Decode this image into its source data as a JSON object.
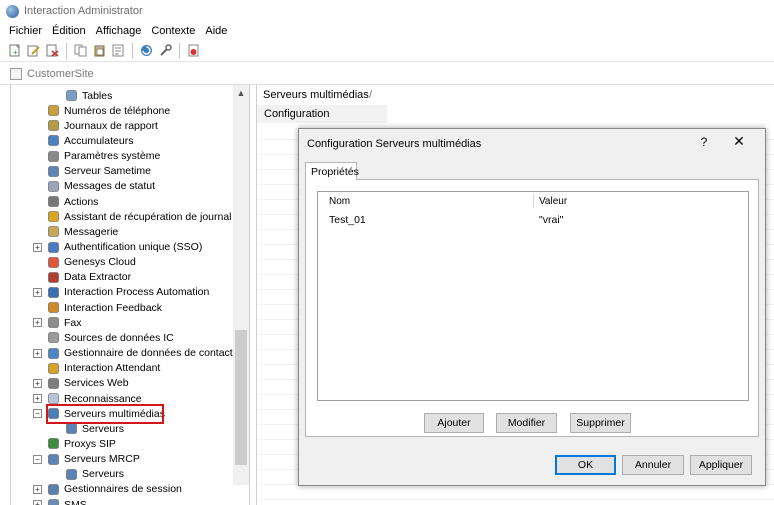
{
  "window": {
    "title": "Interaction Administrator"
  },
  "menu": [
    "Fichier",
    "Édition",
    "Affichage",
    "Contexte",
    "Aide"
  ],
  "site": {
    "name": "CustomerSite"
  },
  "tree": {
    "items": [
      {
        "label": "Tables",
        "icon": "table-icon"
      },
      {
        "label": "Numéros de téléphone",
        "icon": "phone-numbers-icon"
      },
      {
        "label": "Journaux de rapport",
        "icon": "report-logs-icon"
      },
      {
        "label": "Accumulateurs",
        "icon": "accumulators-icon"
      },
      {
        "label": "Paramètres système",
        "icon": "system-parameters-icon"
      },
      {
        "label": "Serveur Sametime",
        "icon": "sametime-server-icon"
      },
      {
        "label": "Messages de statut",
        "icon": "status-messages-icon"
      },
      {
        "label": "Actions",
        "icon": "actions-icon"
      },
      {
        "label": "Assistant de récupération de journal",
        "icon": "log-retrieval-icon"
      },
      {
        "label": "Messagerie",
        "icon": "messaging-icon"
      },
      {
        "label": "Authentification unique (SSO)",
        "icon": "sso-icon"
      },
      {
        "label": "Genesys Cloud",
        "icon": "genesys-cloud-icon"
      },
      {
        "label": "Data Extractor",
        "icon": "data-extractor-icon"
      },
      {
        "label": "Interaction Process Automation",
        "icon": "ipa-icon"
      },
      {
        "label": "Interaction Feedback",
        "icon": "feedback-icon"
      },
      {
        "label": "Fax",
        "icon": "fax-icon"
      },
      {
        "label": "Sources de données IC",
        "icon": "data-sources-icon"
      },
      {
        "label": "Gestionnaire de données de contact",
        "icon": "contact-data-icon"
      },
      {
        "label": "Interaction Attendant",
        "icon": "attendant-icon"
      },
      {
        "label": "Services Web",
        "icon": "web-services-icon"
      },
      {
        "label": "Reconnaissance",
        "icon": "recognition-icon"
      },
      {
        "label": "Serveurs multimédias",
        "icon": "media-servers-icon"
      },
      {
        "label": "Serveurs",
        "icon": "servers-icon"
      },
      {
        "label": "Proxys SIP",
        "icon": "sip-proxy-icon"
      },
      {
        "label": "Serveurs MRCP",
        "icon": "mrcp-servers-icon"
      },
      {
        "label": "Serveurs",
        "icon": "servers-icon"
      },
      {
        "label": "Gestionnaires de session",
        "icon": "session-managers-icon"
      },
      {
        "label": "SMS",
        "icon": "sms-icon"
      }
    ]
  },
  "right_panel": {
    "breadcrumb": "Serveurs multimédias",
    "breadcrumb_sep": "/",
    "row_label": "Configuration"
  },
  "dialog": {
    "title": "Configuration Serveurs multimédias",
    "help": "?",
    "close": "✕",
    "tab": "Propriétés",
    "columns": {
      "name": "Nom",
      "value": "Valeur"
    },
    "rows": [
      {
        "name": "Test_01",
        "value": "\"vrai\""
      }
    ],
    "buttons": {
      "add": "Ajouter",
      "modify": "Modifier",
      "delete": "Supprimer",
      "ok": "OK",
      "cancel": "Annuler",
      "apply": "Appliquer"
    }
  },
  "colors": {
    "highlight": "#d3161c",
    "default_button": "#0078d7"
  }
}
